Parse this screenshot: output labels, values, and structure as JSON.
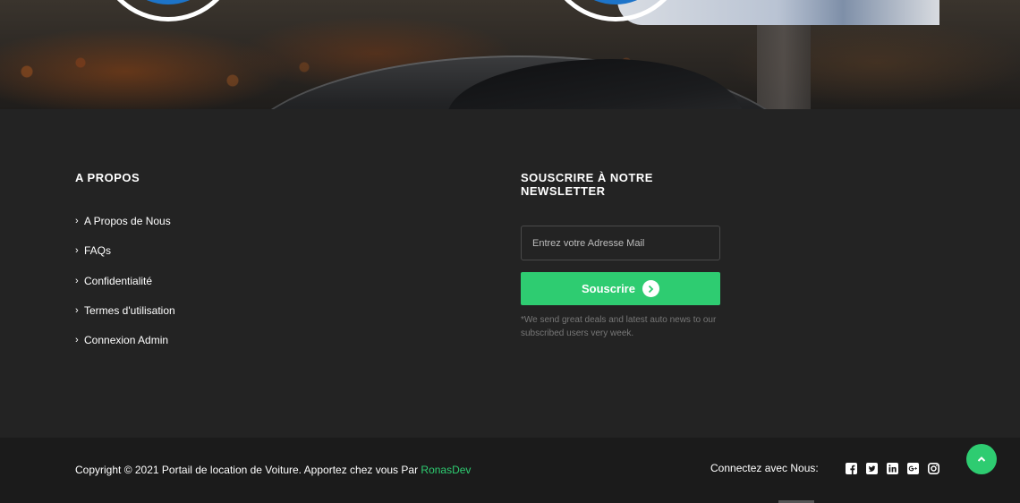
{
  "about": {
    "heading": "A PROPOS",
    "links": [
      {
        "label": "A Propos de Nous"
      },
      {
        "label": "FAQs"
      },
      {
        "label": "Confidentialité"
      },
      {
        "label": "Termes d'utilisation"
      },
      {
        "label": "Connexion Admin"
      }
    ]
  },
  "newsletter": {
    "heading": "SOUSCRIRE À NOTRE NEWSLETTER",
    "email_placeholder": "Entrez votre Adresse Mail",
    "email_value": "",
    "subscribe_label": "Souscrire",
    "note": "*We send great deals and latest auto news to our subscribed users very week."
  },
  "bottom": {
    "copyright_text": "Copyright © 2021 Portail de location de Voiture. Apportez chez vous Par ",
    "brand": "RonasDev",
    "connect_label": "Connectez avec Nous:",
    "social_icons": [
      "facebook-icon",
      "twitter-icon",
      "linkedin-icon",
      "google-plus-icon",
      "instagram-icon"
    ]
  },
  "colors": {
    "accent": "#2ecc71",
    "settings_tab": "#e23a3a",
    "footer_bg": "#232323",
    "bottom_bar_bg": "#1b1b1b"
  }
}
